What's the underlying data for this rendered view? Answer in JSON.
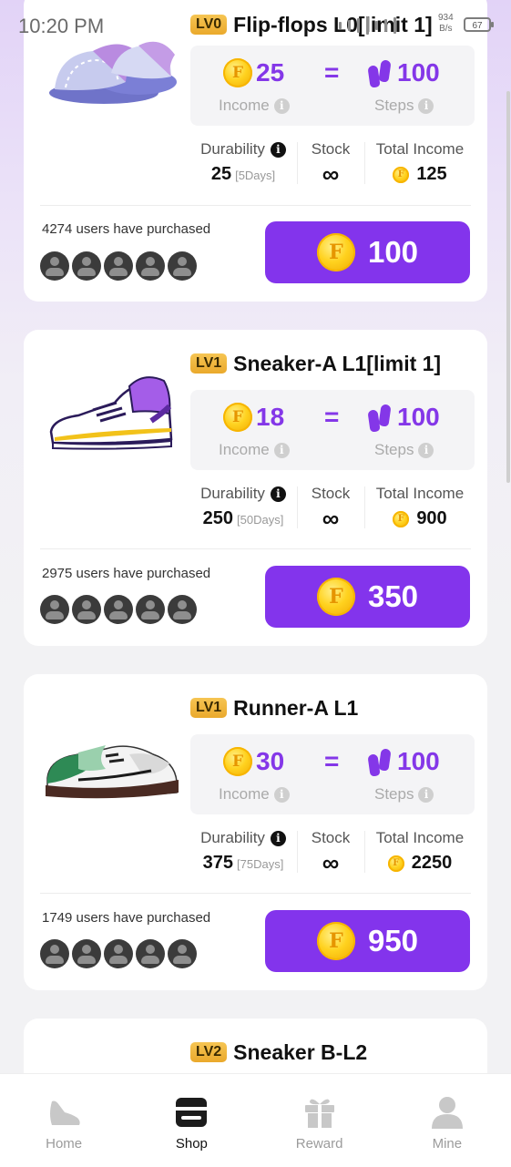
{
  "status_bar": {
    "time": "10:20 PM",
    "speed_value": "934",
    "speed_unit": "B/s",
    "battery": "67"
  },
  "labels": {
    "income": "Income",
    "steps": "Steps",
    "durability": "Durability",
    "stock": "Stock",
    "total_income": "Total Income",
    "equals": "=",
    "infinity": "∞",
    "coin_letter": "F"
  },
  "products": [
    {
      "level": "LV0",
      "name": "Flip-flops L0[limit 1]",
      "income": "25",
      "steps": "100",
      "durability": "25",
      "durability_days": "[5Days]",
      "total_income": "125",
      "purchased": "4274 users have purchased",
      "price": "100"
    },
    {
      "level": "LV1",
      "name": "Sneaker-A L1[limit 1]",
      "income": "18",
      "steps": "100",
      "durability": "250",
      "durability_days": "[50Days]",
      "total_income": "900",
      "purchased": "2975 users have purchased",
      "price": "350"
    },
    {
      "level": "LV1",
      "name": "Runner-A L1",
      "income": "30",
      "steps": "100",
      "durability": "375",
      "durability_days": "[75Days]",
      "total_income": "2250",
      "purchased": "1749 users have purchased",
      "price": "950"
    },
    {
      "level": "LV2",
      "name": "Sneaker B-L2"
    }
  ],
  "nav": [
    {
      "label": "Home",
      "icon": "shoe-icon"
    },
    {
      "label": "Shop",
      "icon": "shop-icon",
      "active": true
    },
    {
      "label": "Reward",
      "icon": "gift-icon"
    },
    {
      "label": "Mine",
      "icon": "user-icon"
    }
  ],
  "colors": {
    "accent": "#8334ec",
    "level_badge": "#f2b840",
    "coin": "#ffd21f"
  }
}
